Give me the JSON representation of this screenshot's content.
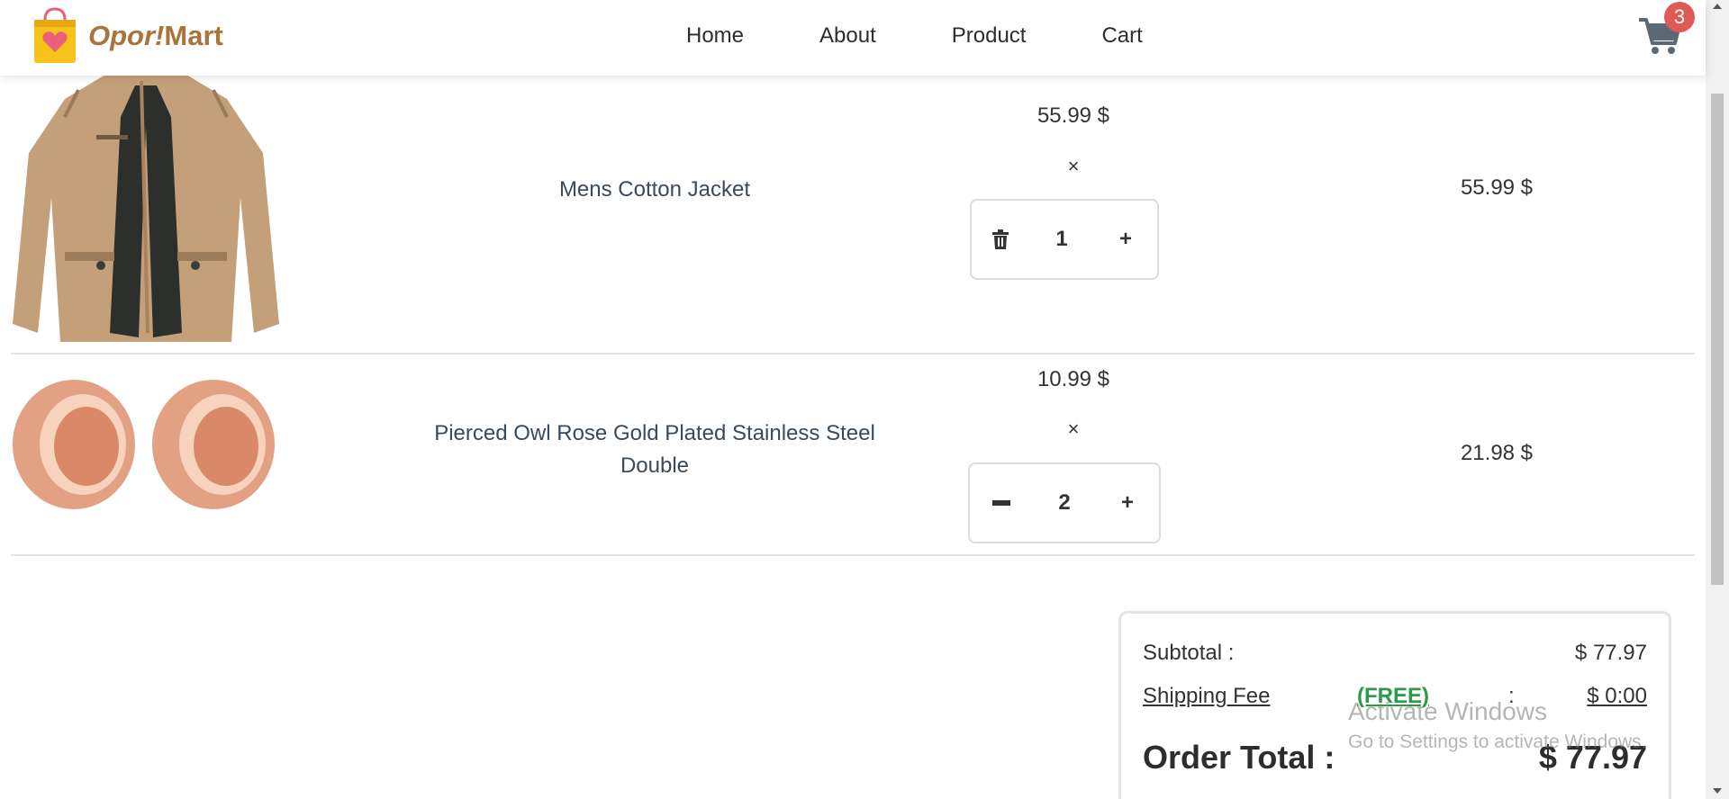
{
  "header": {
    "logo_part1": "Opor!",
    "logo_part2": "Mart",
    "nav": [
      "Home",
      "About",
      "Product",
      "Cart"
    ],
    "cart_count": "3"
  },
  "cart": [
    {
      "title": "Mens Cotton Jacket",
      "unit_price": "55.99 $",
      "times": "×",
      "quantity": "1",
      "line_total": "55.99 $",
      "decrement_icon": "trash-icon"
    },
    {
      "title": "Pierced Owl Rose Gold Plated Stainless Steel Double",
      "unit_price": "10.99 $",
      "times": "×",
      "quantity": "2",
      "line_total": "21.98 $",
      "decrement_icon": "minus-icon"
    }
  ],
  "summary": {
    "subtotal_label": "Subtotal :",
    "subtotal_value": "$ 77.97",
    "shipping_label": "Shipping Fee",
    "shipping_free": "(FREE)",
    "shipping_colon": ":",
    "shipping_value": "$ 0:00",
    "total_label": "Order Total :",
    "total_value": "$ 77.97"
  },
  "watermark": {
    "line1": "Activate Windows",
    "line2": "Go to Settings to activate Windows."
  },
  "colors": {
    "brand": "#a8743a",
    "badge": "#e05a55",
    "free": "#2d9a4a"
  }
}
